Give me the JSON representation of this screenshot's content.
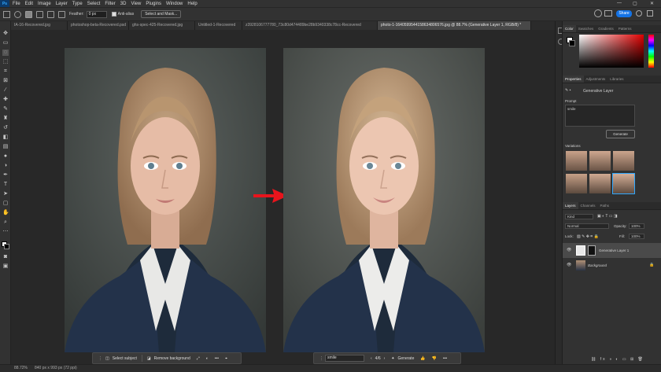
{
  "app": {
    "logo": "Ps",
    "accent": "#31a8ff",
    "share_color": "#1473e6"
  },
  "menu": [
    "File",
    "Edit",
    "Image",
    "Layer",
    "Type",
    "Select",
    "Filter",
    "3D",
    "View",
    "Plugins",
    "Window",
    "Help"
  ],
  "window_controls": {
    "minimize": "—",
    "maximize": "▢",
    "close": "✕"
  },
  "options_bar": {
    "feather_label": "Feather:",
    "feather_value": "0 px",
    "antialias_label": "Anti-alias",
    "select_mask_label": "Select and Mask...",
    "share_label": "Share"
  },
  "tabs": [
    {
      "label": "IA-16-Recovered.jpg"
    },
    {
      "label": "photoshop-beta-Recovered.psd"
    },
    {
      "label": "ghs-spec-425-Recovered.jpg"
    },
    {
      "label": "Untitled-1-Recovered"
    },
    {
      "label": "z3928106777780_73c80d474489be28b9340338c78cc-Recovered"
    },
    {
      "label": "photo-1-1640599544158634806576.jpg @ 88.7% (Generative Layer 1, RGB/8) *"
    }
  ],
  "context_bar_left": {
    "select_subject": "Select subject",
    "remove_background": "Remove background",
    "more": "•••"
  },
  "context_bar_right": {
    "prompt_value": "smile",
    "counter": "4/6",
    "generate": "Generate",
    "more": "•••"
  },
  "status": {
    "zoom": "88.72%",
    "dimensions": "840 px x 993 px (72 ppi)"
  },
  "color_panel": {
    "tabs": [
      "Color",
      "Swatches",
      "Gradients",
      "Patterns"
    ]
  },
  "properties_panel": {
    "tabs": [
      "Properties",
      "Adjustments",
      "Libraries"
    ],
    "layer_type": "Generative Layer",
    "prompt_label": "Prompt",
    "prompt_value": "smile",
    "generate_label": "Generate",
    "variations_label": "Variations"
  },
  "layers_panel": {
    "tabs": [
      "Layers",
      "Channels",
      "Paths"
    ],
    "filter_value": "Kind",
    "blend_mode": "Normal",
    "opacity_label": "Opacity:",
    "opacity_value": "100%",
    "lock_label": "Lock:",
    "fill_label": "Fill:",
    "fill_value": "100%",
    "layers": [
      {
        "name": "Generative Layer 1",
        "selected": true
      },
      {
        "name": "Background",
        "selected": false
      }
    ]
  },
  "arrow_color": "#e8141c"
}
